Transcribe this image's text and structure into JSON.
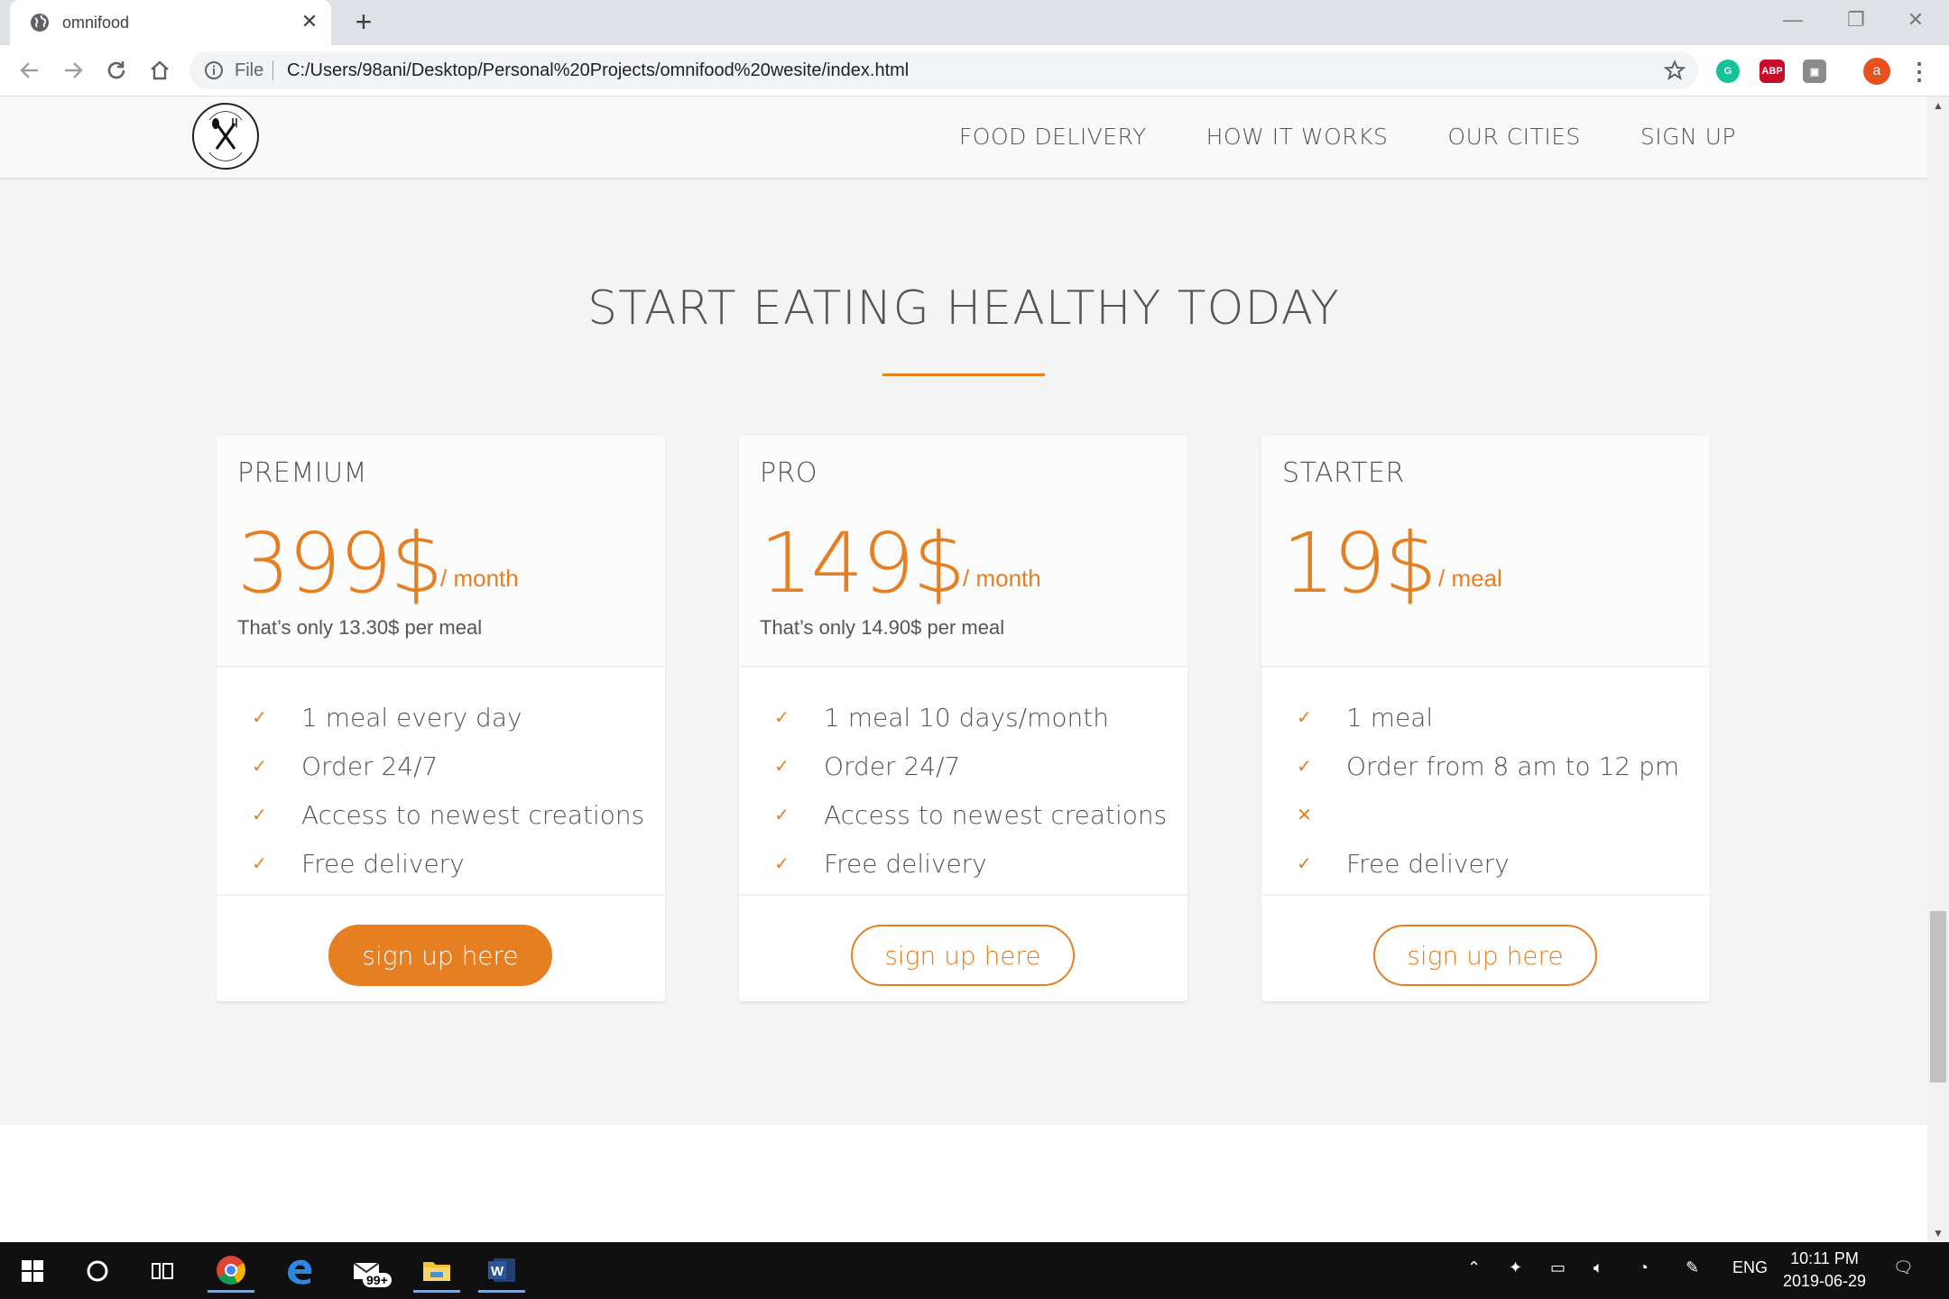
{
  "browser": {
    "tab_title": "omnifood",
    "tab_close": "✕",
    "new_tab": "+",
    "scheme_label": "File",
    "url": "C:/Users/98ani/Desktop/Personal%20Projects/omnifood%20wesite/index.html",
    "profile_initial": "a",
    "ext_abp": "ABP",
    "window_controls": [
      "—",
      "❐",
      "✕"
    ]
  },
  "page": {
    "logo_alt": "omnifood logo",
    "nav": [
      "FOOD DELIVERY",
      "HOW IT WORKS",
      "OUR CITIES",
      "SIGN UP"
    ],
    "section_title": "START EATING HEALTHY TODAY",
    "accent_color": "#e67e22",
    "plans": [
      {
        "name": "PREMIUM",
        "price": "399$",
        "per": "/ month",
        "note": "That’s only 13.30$ per meal",
        "features": [
          {
            "mark": "✓",
            "text": "1 meal every day"
          },
          {
            "mark": "✓",
            "text": "Order 24/7"
          },
          {
            "mark": "✓",
            "text": "Access to newest creations"
          },
          {
            "mark": "✓",
            "text": "Free delivery"
          }
        ],
        "button": "sign up here",
        "button_style": "full"
      },
      {
        "name": "PRO",
        "price": "149$",
        "per": "/ month",
        "note": "That’s only 14.90$ per meal",
        "features": [
          {
            "mark": "✓",
            "text": "1 meal 10 days/month"
          },
          {
            "mark": "✓",
            "text": "Order 24/7"
          },
          {
            "mark": "✓",
            "text": "Access to newest creations"
          },
          {
            "mark": "✓",
            "text": "Free delivery"
          }
        ],
        "button": "sign up here",
        "button_style": "ghost"
      },
      {
        "name": "STARTER",
        "price": "19$",
        "per": "/ meal",
        "note": "",
        "features": [
          {
            "mark": "✓",
            "text": "1 meal"
          },
          {
            "mark": "✓",
            "text": "Order from 8 am to 12 pm"
          },
          {
            "mark": "✕",
            "text": ""
          },
          {
            "mark": "✓",
            "text": "Free delivery"
          }
        ],
        "button": "sign up here",
        "button_style": "ghost"
      }
    ]
  },
  "taskbar": {
    "notifications_badge": "99+",
    "language": "ENG",
    "time": "10:11 PM",
    "date": "2019-06-29"
  }
}
